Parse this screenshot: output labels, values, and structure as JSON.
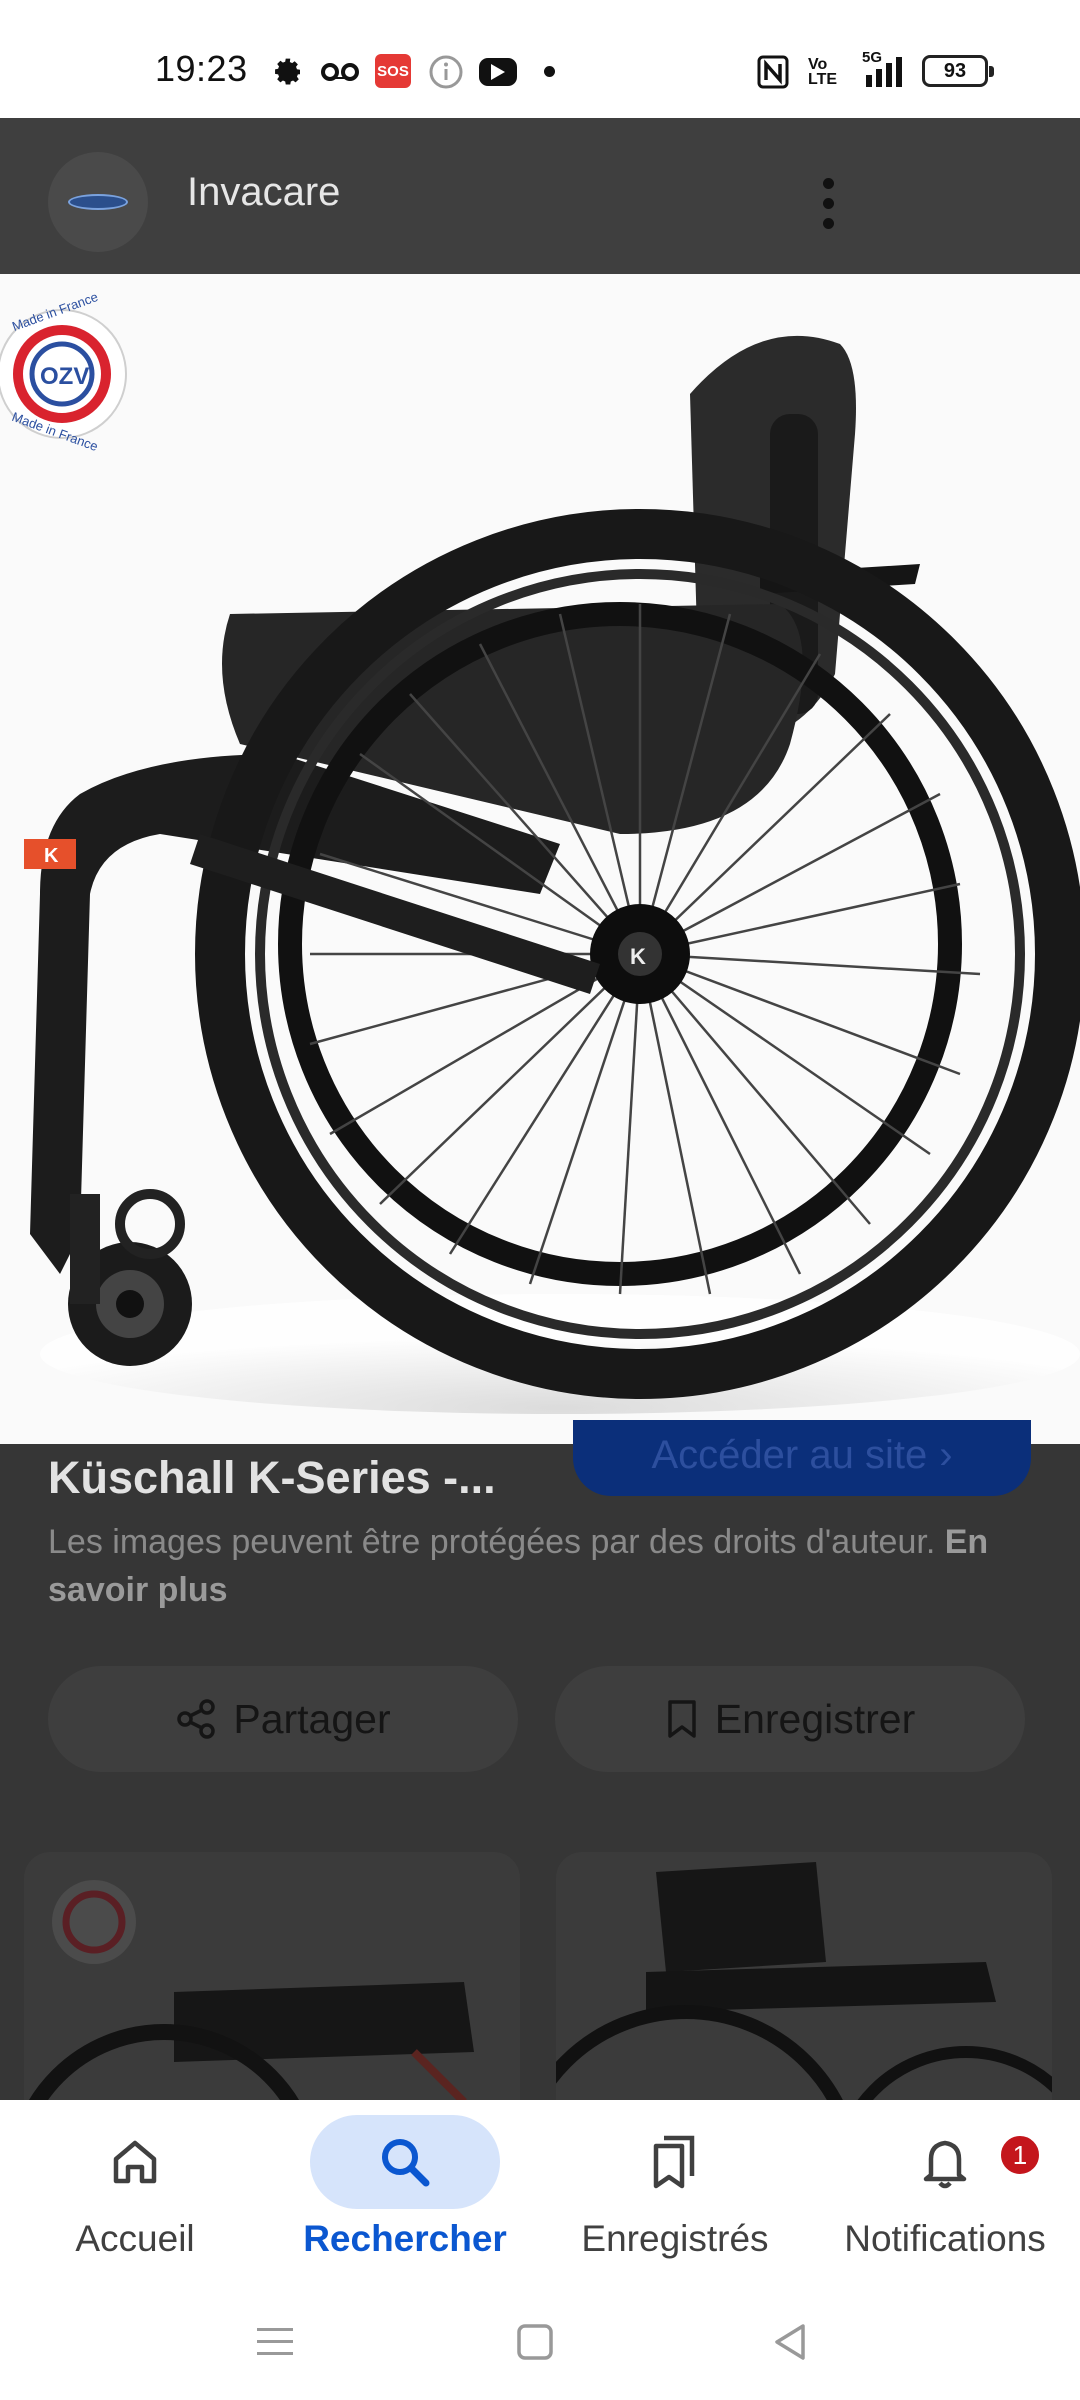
{
  "status_bar": {
    "time": "19:23",
    "sos": "SOS",
    "volte": "Vo LTE",
    "network": "5G",
    "battery": "93",
    "icons": [
      "gear-icon",
      "voicemail-icon",
      "sos-icon",
      "info-icon",
      "youtube-icon",
      "dot-icon",
      "nfc-icon",
      "volte-icon",
      "signal-5g-icon",
      "battery-icon"
    ]
  },
  "viewer": {
    "site_name": "Invacare",
    "title": "Küschall K-Series -...",
    "visit_label": "Accéder au site",
    "copyright_text": "Les images peuvent être protégées par des droits d'auteur.",
    "learn_more": "En savoir plus",
    "share_label": "Partager",
    "save_label": "Enregistrer",
    "badge_text_top": "Made in France",
    "badge_text_bottom": "Made in France"
  },
  "bottom_nav": {
    "items": [
      {
        "label": "Accueil",
        "icon": "home-icon",
        "active": false
      },
      {
        "label": "Rechercher",
        "icon": "search-icon",
        "active": true
      },
      {
        "label": "Enregistrés",
        "icon": "saved-collections-icon",
        "active": false
      },
      {
        "label": "Notifications",
        "icon": "bell-icon",
        "active": false,
        "badge": "1"
      }
    ]
  },
  "colors": {
    "accent": "#0b57d0",
    "active_pill": "#d6e4fb",
    "badge": "#c4161c",
    "overlay_bg": "#363636"
  }
}
